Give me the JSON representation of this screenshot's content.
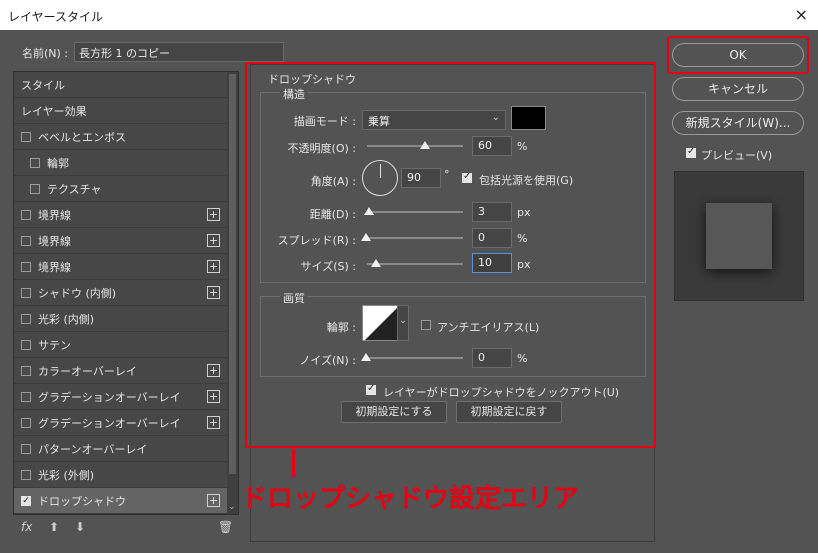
{
  "window": {
    "title": "レイヤースタイル",
    "close_icon": "×"
  },
  "name_field": {
    "label": "名前(N) :",
    "value": "長方形 1 のコピー"
  },
  "layer_list": {
    "items": [
      {
        "label": "スタイル",
        "checkbox": false,
        "plus": false,
        "checked": false
      },
      {
        "label": "レイヤー効果",
        "checkbox": false,
        "plus": false,
        "checked": false
      },
      {
        "label": "ベベルとエンボス",
        "checkbox": true,
        "plus": false,
        "checked": false
      },
      {
        "label": "輪郭",
        "checkbox": true,
        "plus": false,
        "checked": false,
        "indent": true
      },
      {
        "label": "テクスチャ",
        "checkbox": true,
        "plus": false,
        "checked": false,
        "indent": true
      },
      {
        "label": "境界線",
        "checkbox": true,
        "plus": true,
        "checked": false
      },
      {
        "label": "境界線",
        "checkbox": true,
        "plus": true,
        "checked": false
      },
      {
        "label": "境界線",
        "checkbox": true,
        "plus": true,
        "checked": false
      },
      {
        "label": "シャドウ (内側)",
        "checkbox": true,
        "plus": true,
        "checked": false
      },
      {
        "label": "光彩 (内側)",
        "checkbox": true,
        "plus": false,
        "checked": false
      },
      {
        "label": "サテン",
        "checkbox": true,
        "plus": false,
        "checked": false
      },
      {
        "label": "カラーオーバーレイ",
        "checkbox": true,
        "plus": true,
        "checked": false
      },
      {
        "label": "グラデーションオーバーレイ",
        "checkbox": true,
        "plus": true,
        "checked": false
      },
      {
        "label": "グラデーションオーバーレイ",
        "checkbox": true,
        "plus": true,
        "checked": false
      },
      {
        "label": "パターンオーバーレイ",
        "checkbox": true,
        "plus": false,
        "checked": false
      },
      {
        "label": "光彩 (外側)",
        "checkbox": true,
        "plus": false,
        "checked": false
      },
      {
        "label": "ドロップシャドウ",
        "checkbox": true,
        "plus": true,
        "checked": true,
        "active": true
      }
    ],
    "footer": {
      "fx": "fx",
      "up": "⬆",
      "down": "⬇",
      "trash": "🗑"
    }
  },
  "drop_shadow": {
    "title": "ドロップシャドウ",
    "structure": {
      "title": "構造",
      "blend_mode_label": "描画モード :",
      "blend_mode_value": "乗算",
      "opacity_label": "不透明度(O) :",
      "opacity_value": "60",
      "opacity_unit": "%",
      "opacity_level": 0.6,
      "angle_label": "角度(A) :",
      "angle_value": "90",
      "angle_unit": "°",
      "global_light_label": "包括光源を使用(G)",
      "distance_label": "距離(D) :",
      "distance_value": "3",
      "distance_unit": "px",
      "spread_label": "スプレッド(R) :",
      "spread_value": "0",
      "spread_unit": "%",
      "size_label": "サイズ(S) :",
      "size_value": "10",
      "size_unit": "px"
    },
    "quality": {
      "title": "画質",
      "contour_label": "輪郭 :",
      "antialias_label": "アンチエイリアス(L)",
      "noise_label": "ノイズ(N) :",
      "noise_value": "0",
      "noise_unit": "%"
    },
    "knockout_label": "レイヤーがドロップシャドウをノックアウト(U)",
    "reset_default_button": "初期設定にする",
    "restore_default_button": "初期設定に戻す",
    "shadow_color": "#000000"
  },
  "right_panel": {
    "ok": "OK",
    "cancel": "キャンセル",
    "new_style": "新規スタイル(W)...",
    "preview_label": "プレビュー(V)"
  },
  "annotation": {
    "text": "ドロップシャドウ設定エリア",
    "color": "#e60012"
  }
}
